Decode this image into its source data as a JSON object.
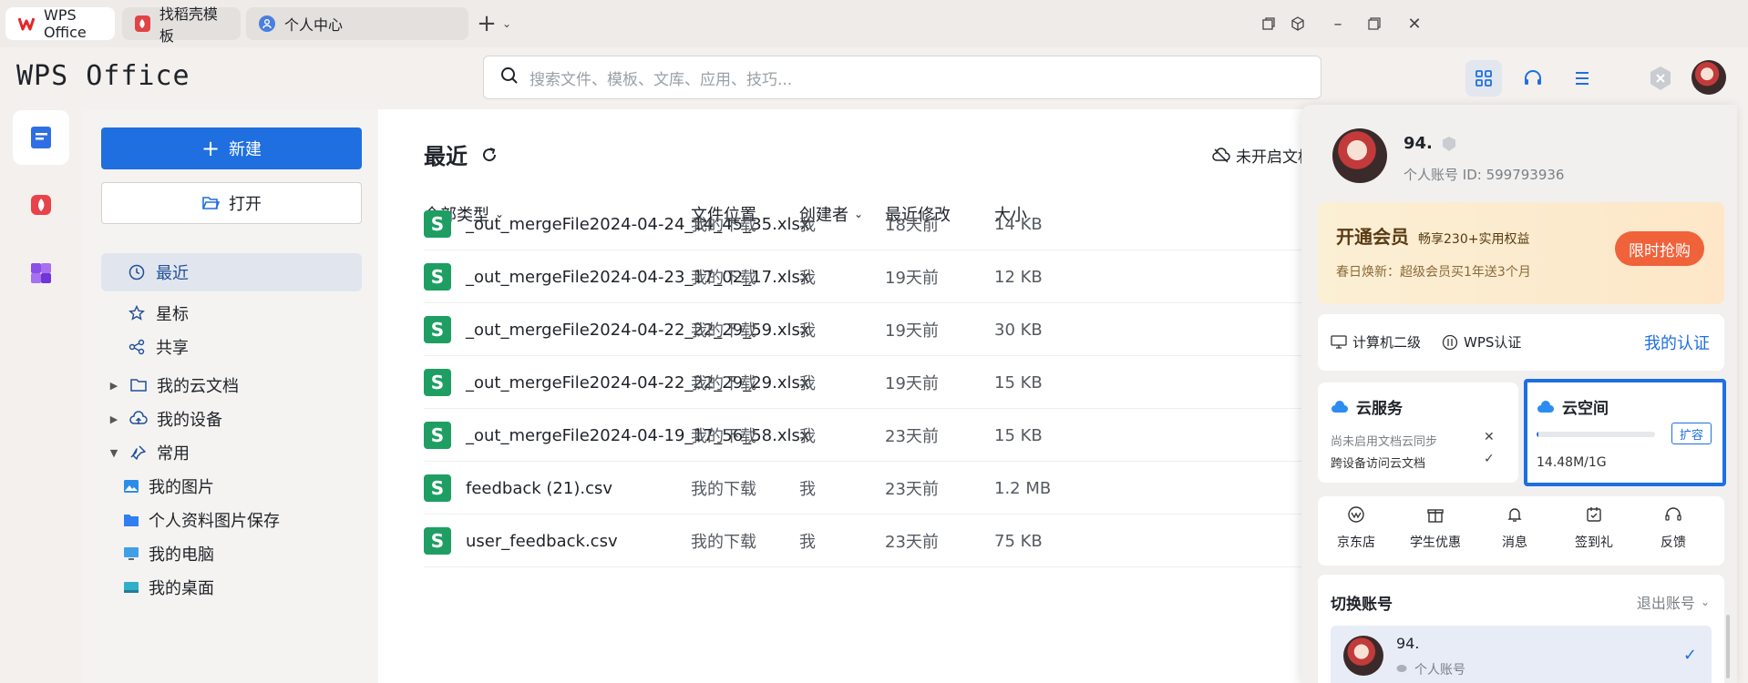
{
  "tabs": [
    {
      "label": "WPS Office",
      "icon": "wps-logo-icon"
    },
    {
      "label": "找稻壳模板",
      "icon": "docer-icon"
    },
    {
      "label": "个人中心",
      "icon": "user-icon"
    }
  ],
  "header": {
    "logo": "WPS Office",
    "search_placeholder": "搜索文件、模板、文库、应用、技巧..."
  },
  "nav": {
    "new_label": "新建",
    "open_label": "打开",
    "items": [
      {
        "label": "最近",
        "icon": "clock-icon",
        "active": true
      },
      {
        "label": "星标",
        "icon": "star-icon"
      },
      {
        "label": "共享",
        "icon": "share-icon"
      }
    ],
    "tree": [
      {
        "label": "我的云文档",
        "icon": "folder-icon",
        "caret": "▶"
      },
      {
        "label": "我的设备",
        "icon": "cloud-upload-icon",
        "caret": "▶"
      },
      {
        "label": "常用",
        "icon": "pin-icon",
        "caret": "▼"
      },
      {
        "label": "我的图片",
        "icon": "picture-icon"
      },
      {
        "label": "个人资料图片保存",
        "icon": "blue-folder-icon"
      },
      {
        "label": "我的电脑",
        "icon": "computer-icon"
      },
      {
        "label": "我的桌面",
        "icon": "desktop-icon"
      }
    ]
  },
  "main": {
    "title": "最近",
    "sync_status": "未开启文档云同步",
    "columns": {
      "type": "全部类型",
      "location": "文件位置",
      "creator": "创建者",
      "modified": "最近修改",
      "size": "大小"
    },
    "rows": [
      {
        "name": "_out_mergeFile2024-04-24_14_45_35.xlsx",
        "location": "我的下载",
        "creator": "我",
        "modified": "18天前",
        "size": "14 KB"
      },
      {
        "name": "_out_mergeFile2024-04-23_17_02_17.xlsx",
        "location": "我的下载",
        "creator": "我",
        "modified": "19天前",
        "size": "12 KB"
      },
      {
        "name": "_out_mergeFile2024-04-22_22_29_59.xlsx",
        "location": "我的下载",
        "creator": "我",
        "modified": "19天前",
        "size": "30 KB"
      },
      {
        "name": "_out_mergeFile2024-04-22_22_29_29.xlsx",
        "location": "我的下载",
        "creator": "我",
        "modified": "19天前",
        "size": "15 KB"
      },
      {
        "name": "_out_mergeFile2024-04-19_17_56_58.xlsx",
        "location": "我的下载",
        "creator": "我",
        "modified": "23天前",
        "size": "15 KB"
      },
      {
        "name": "feedback (21).csv",
        "location": "我的下载",
        "creator": "我",
        "modified": "23天前",
        "size": "1.2 MB"
      },
      {
        "name": "user_feedback.csv",
        "location": "我的下载",
        "creator": "我",
        "modified": "23天前",
        "size": "75 KB"
      }
    ],
    "file_icon_letter": "S"
  },
  "account": {
    "name": "94.",
    "account_line": "个人账号 ID: 599793936",
    "vip_title": "开通会员",
    "vip_benefit": "畅享230+实用权益",
    "vip_promo": "春日焕新：超级会员买1年送3个月",
    "vip_button": "限时抢购",
    "cert_items": [
      "计算机二级",
      "WPS认证"
    ],
    "cert_link": "我的认证",
    "cloud_service": {
      "title": "云服务",
      "line1": "尚未启用文档云同步",
      "line2": "跨设备访问云文档"
    },
    "cloud_space": {
      "title": "云空间",
      "expand": "扩容",
      "usage": "14.48M/1G",
      "used_fraction": 0.014
    },
    "shortcuts": [
      {
        "label": "京东店",
        "icon": "jd-icon"
      },
      {
        "label": "学生优惠",
        "icon": "gift-icon"
      },
      {
        "label": "消息",
        "icon": "bell-icon"
      },
      {
        "label": "签到礼",
        "icon": "calendar-check-icon"
      },
      {
        "label": "反馈",
        "icon": "headset-icon"
      }
    ],
    "switch_title": "切换账号",
    "logout": "退出账号",
    "current_account": {
      "name": "94.",
      "type": "个人账号"
    }
  },
  "colors": {
    "accent": "#1f6fe0",
    "sheet_green": "#1e9e63",
    "vip_orange": "#f0623a",
    "highlight_border": "#1f6fe0"
  }
}
